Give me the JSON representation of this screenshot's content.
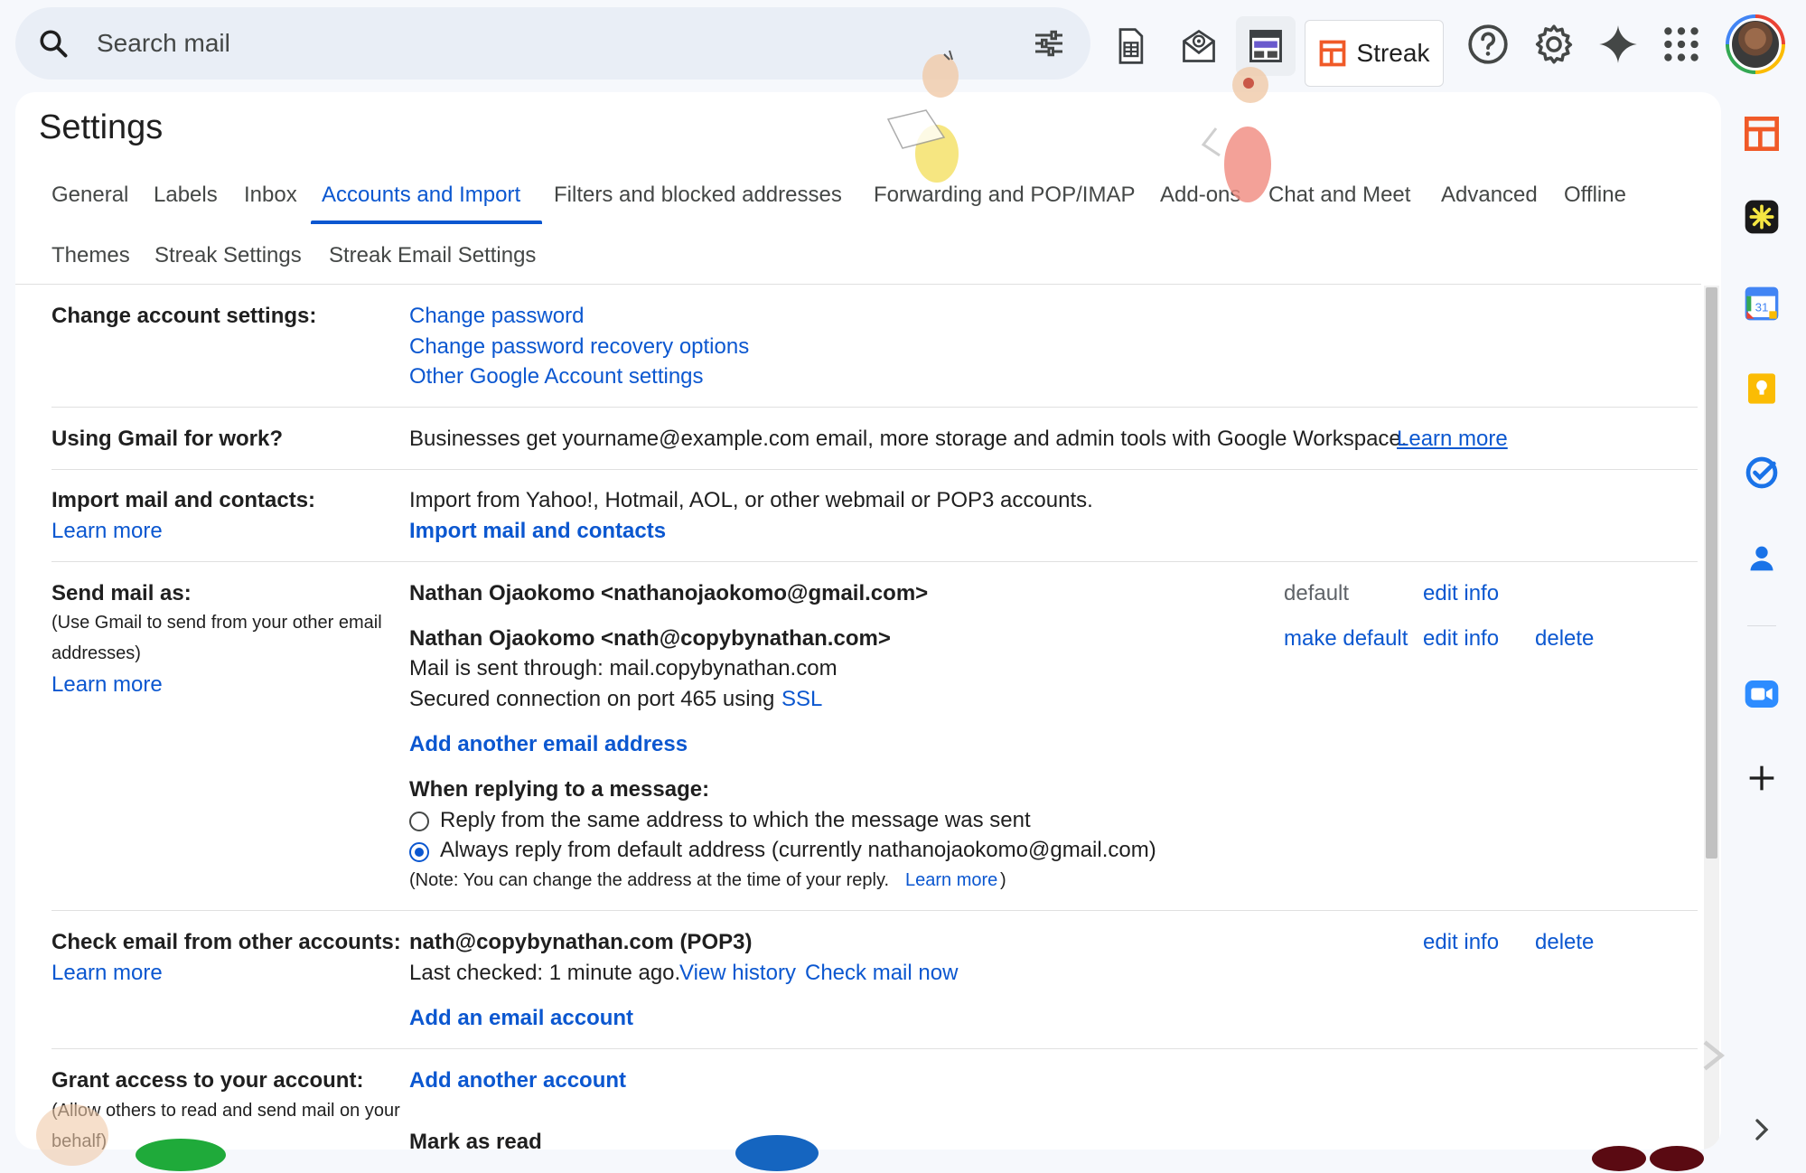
{
  "search": {
    "placeholder": "Search mail"
  },
  "toolbar": {
    "streak_label": "Streak"
  },
  "settings": {
    "title": "Settings",
    "tabs_row1": [
      "General",
      "Labels",
      "Inbox",
      "Accounts and Import",
      "Filters and blocked addresses",
      "Forwarding and POP/IMAP",
      "Add-ons",
      "Chat and Meet",
      "Advanced",
      "Offline"
    ],
    "tabs_row2": [
      "Themes",
      "Streak Settings",
      "Streak Email Settings"
    ],
    "active_tab": "Accounts and Import"
  },
  "change_account": {
    "label": "Change account settings:",
    "links": [
      "Change password",
      "Change password recovery options",
      "Other Google Account settings"
    ]
  },
  "gmail_work": {
    "label": "Using Gmail for work?",
    "text": "Businesses get yourname@example.com email, more storage and admin tools with Google Workspace.",
    "link": "Learn more"
  },
  "import": {
    "label": "Import mail and contacts:",
    "learn_more": "Learn more",
    "text": "Import from Yahoo!, Hotmail, AOL, or other webmail or POP3 accounts.",
    "action": "Import mail and contacts"
  },
  "send_mail": {
    "label": "Send mail as:",
    "sub_line1": "(Use Gmail to send from your other email",
    "sub_line2": "addresses)",
    "learn_more": "Learn more",
    "address1": "Nathan Ojaokomo <nathanojaokomo@gmail.com>",
    "address1_default": "default",
    "address1_edit": "edit info",
    "address2": "Nathan Ojaokomo <nath@copybynathan.com>",
    "address2_make_default": "make default",
    "address2_edit": "edit info",
    "address2_delete": "delete",
    "sent_through": "Mail is sent through: mail.copybynathan.com",
    "secured_prefix": "Secured connection on port 465 using",
    "secured_link": "SSL",
    "add_address": "Add another email address",
    "reply_heading": "When replying to a message:",
    "reply_option1": "Reply from the same address to which the message was sent",
    "reply_option2": "Always reply from default address (currently nathanojaokomo@gmail.com)",
    "reply_selected": 2,
    "note_prefix": "(Note: You can change the address at the time of your reply.",
    "note_link": "Learn more",
    "note_suffix": ")"
  },
  "check_email": {
    "label": "Check email from other accounts:",
    "learn_more": "Learn more",
    "account": "nath@copybynathan.com (POP3)",
    "edit": "edit info",
    "delete": "delete",
    "last_checked": "Last checked: 1 minute ago.",
    "view_history": "View history",
    "check_now": "Check mail now",
    "add_account": "Add an email account"
  },
  "grant_access": {
    "label": "Grant access to your account:",
    "sub_line1": "(Allow others to read and send mail on your",
    "sub_line2": "behalf)",
    "add_account": "Add another account",
    "mark_as_read": "Mark as read"
  },
  "colors": {
    "link": "#0b57d0",
    "background": "#f6f8fc",
    "search_bg": "#e9eef6"
  },
  "icons": [
    "search-icon",
    "tune-icon",
    "sheet-icon",
    "mail-badge-icon",
    "layout-icon",
    "streak-icon",
    "help-icon",
    "gear-icon",
    "gemini-sparkle-icon",
    "apps-grid-icon",
    "streak-sidebar-icon",
    "asana-icon",
    "calendar-icon",
    "keep-icon",
    "tasks-icon",
    "contacts-icon",
    "zoom-icon",
    "add-icon",
    "expand-icon"
  ]
}
